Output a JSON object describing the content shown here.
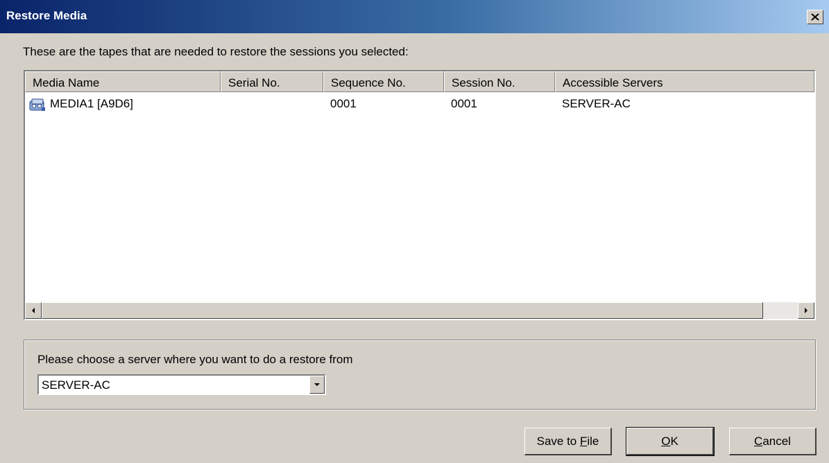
{
  "window": {
    "title": "Restore Media",
    "close_icon": "close-icon"
  },
  "instructions": "These are the tapes that are needed to restore the sessions you selected:",
  "table": {
    "columns": [
      "Media Name",
      "Serial No.",
      "Sequence No.",
      "Session No.",
      "Accessible Servers"
    ],
    "rows": [
      {
        "icon": "tape-media-icon",
        "media_name": "MEDIA1 [A9D6]",
        "serial_no": "",
        "sequence_no": "0001",
        "session_no": "0001",
        "accessible_servers": "SERVER-AC"
      }
    ]
  },
  "server_group": {
    "label": "Please choose a server where you want to do a restore from",
    "selected": "SERVER-AC"
  },
  "buttons": {
    "save_prefix": "Save to ",
    "save_accel": "F",
    "save_suffix": "ile",
    "ok_accel": "O",
    "ok_suffix": "K",
    "cancel_accel": "C",
    "cancel_suffix": "ancel"
  }
}
